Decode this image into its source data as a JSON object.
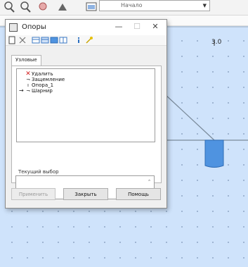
{
  "app": {
    "view_select": {
      "value": "Начало"
    },
    "canvas": {
      "axis_tick_label": "3.0"
    },
    "colors": {
      "canvas_bg": "#cfe3fb",
      "support_block": "#4f93e0"
    }
  },
  "dialog": {
    "title": "Опоры",
    "controls": {
      "minimize": "—",
      "maximize": "☐",
      "close": "✕"
    },
    "toolbar_icons": [
      "new-icon",
      "delete-icon",
      "view1-icon",
      "view2-icon",
      "view3-icon",
      "view4-icon",
      "info-icon",
      "wand-icon"
    ],
    "tab": "Узловые",
    "supports": [
      {
        "icon": "delete-icon",
        "label": "Удалить",
        "arrow": ""
      },
      {
        "icon": "fixed-support-icon",
        "label": "Защемление",
        "arrow": ""
      },
      {
        "icon": "support-icon",
        "label": "Опора_1",
        "arrow": ""
      },
      {
        "icon": "hinge-icon",
        "label": "Шарнир",
        "arrow": "→"
      }
    ],
    "current_selection": {
      "label": "Текущий выбор",
      "value": ""
    },
    "buttons": {
      "apply": "Применить",
      "close": "Закрыть",
      "help": "Помощь"
    }
  }
}
